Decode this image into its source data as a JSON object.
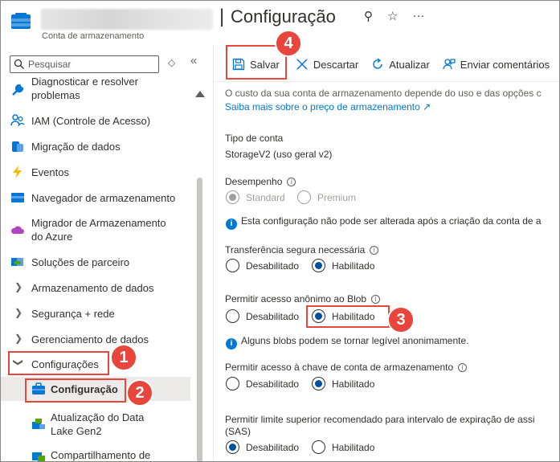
{
  "header": {
    "title": "Configuração",
    "separator": "|",
    "subtitle": "Conta de armazenamento",
    "actions": {
      "pin": "⚲",
      "favorite": "☆",
      "more": "···"
    }
  },
  "sidebar": {
    "search_placeholder": "Pesquisar",
    "filter_icon": "◇",
    "collapse_icon": "«",
    "items": [
      {
        "label": "Diagnosticar e resolver problemas",
        "icon": "wrench-icon"
      },
      {
        "label": "IAM (Controle de Acesso)",
        "icon": "people-icon"
      },
      {
        "label": "Migração de dados",
        "icon": "data-migration-icon"
      },
      {
        "label": "Eventos",
        "icon": "lightning-icon"
      },
      {
        "label": "Navegador de armazenamento",
        "icon": "storage-browser-icon"
      },
      {
        "label": "Migrador de Armazenamento do Azure",
        "icon": "cloud-migrator-icon"
      },
      {
        "label": "Soluções de parceiro",
        "icon": "partner-icon"
      },
      {
        "label": "Armazenamento de dados"
      },
      {
        "label": "Segurança + rede"
      },
      {
        "label": "Gerenciamento de dados"
      },
      {
        "label": "Configurações"
      },
      {
        "label": "Configuração",
        "icon": "briefcase-icon"
      },
      {
        "label": "Atualização do Data Lake Gen2",
        "icon": "data-lake-icon"
      },
      {
        "label": "Compartilhamento de",
        "icon": "share-icon"
      }
    ]
  },
  "toolbar": {
    "save": "Salvar",
    "discard": "Descartar",
    "refresh": "Atualizar",
    "feedback": "Enviar comentários"
  },
  "content": {
    "intro": "O custo da sua conta de armazenamento depende do uso e das opções c",
    "pricing_link": "Saiba mais sobre o preço de armazenamento ↗",
    "account_type_label": "Tipo de conta",
    "account_type_value": "StorageV2 (uso geral v2)",
    "performance_label": "Desempenho",
    "performance_options": [
      "Standard",
      "Premium"
    ],
    "performance_info": "Esta configuração não pode ser alterada após a criação da conta de a",
    "secure_transfer_label": "Transferência segura necessária",
    "disabled": "Desabilitado",
    "enabled": "Habilitado",
    "blob_anon_label": "Permitir acesso anônimo ao Blob",
    "blob_anon_info": "Alguns blobs podem se tornar legível anonimamente.",
    "key_access_label": "Permitir acesso à chave de conta de armazenamento",
    "sas_label_line1": "Permitir limite superior recomendado para intervalo de expiração de assi",
    "sas_label_line2": "(SAS)"
  },
  "callouts": [
    "1",
    "2",
    "3",
    "4"
  ],
  "colors": {
    "accent": "#0078d4",
    "callout": "#e8453c",
    "selected_nav": "#edebe9"
  }
}
